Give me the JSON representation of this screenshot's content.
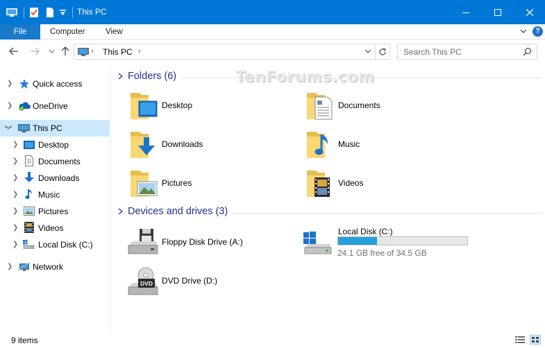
{
  "window": {
    "title": "This PC"
  },
  "ribbon": {
    "tabs": [
      "File",
      "Computer",
      "View"
    ]
  },
  "address": {
    "path": "This PC"
  },
  "search": {
    "placeholder": "Search This PC"
  },
  "watermark": "TenForums.com",
  "nav": {
    "items": [
      {
        "label": "Quick access",
        "icon": "quick-access-star-icon"
      },
      {
        "label": "OneDrive",
        "icon": "onedrive-cloud-icon"
      },
      {
        "label": "This PC",
        "icon": "this-pc-monitor-icon",
        "selected": true
      },
      {
        "label": "Desktop",
        "icon": "desktop-icon"
      },
      {
        "label": "Documents",
        "icon": "documents-icon"
      },
      {
        "label": "Downloads",
        "icon": "downloads-arrow-icon"
      },
      {
        "label": "Music",
        "icon": "music-note-icon"
      },
      {
        "label": "Pictures",
        "icon": "pictures-icon"
      },
      {
        "label": "Videos",
        "icon": "videos-film-icon"
      },
      {
        "label": "Local Disk (C:)",
        "icon": "local-disk-icon"
      },
      {
        "label": "Network",
        "icon": "network-icon"
      }
    ]
  },
  "folders": {
    "header": "Folders (6)",
    "items": [
      {
        "label": "Desktop",
        "icon": "desktop-folder-icon"
      },
      {
        "label": "Documents",
        "icon": "documents-folder-icon"
      },
      {
        "label": "Downloads",
        "icon": "downloads-folder-icon"
      },
      {
        "label": "Music",
        "icon": "music-folder-icon"
      },
      {
        "label": "Pictures",
        "icon": "pictures-folder-icon"
      },
      {
        "label": "Videos",
        "icon": "videos-folder-icon"
      }
    ]
  },
  "drives": {
    "header": "Devices and drives (3)",
    "items": [
      {
        "label": "Floppy Disk Drive (A:)",
        "icon": "floppy-drive-icon"
      },
      {
        "label": "Local Disk (C:)",
        "icon": "local-disk-windows-icon",
        "free_text": "24.1 GB free of 34.5 GB",
        "used_fraction": 0.3
      },
      {
        "label": "DVD Drive (D:)",
        "icon": "dvd-drive-icon"
      }
    ]
  },
  "status": {
    "items_text": "9 items"
  },
  "colors": {
    "accent": "#0078d7",
    "file_tab": "#1979ca",
    "section_header": "#1e3287",
    "selection": "#cce8ff",
    "drive_bar": "#26a0da"
  }
}
